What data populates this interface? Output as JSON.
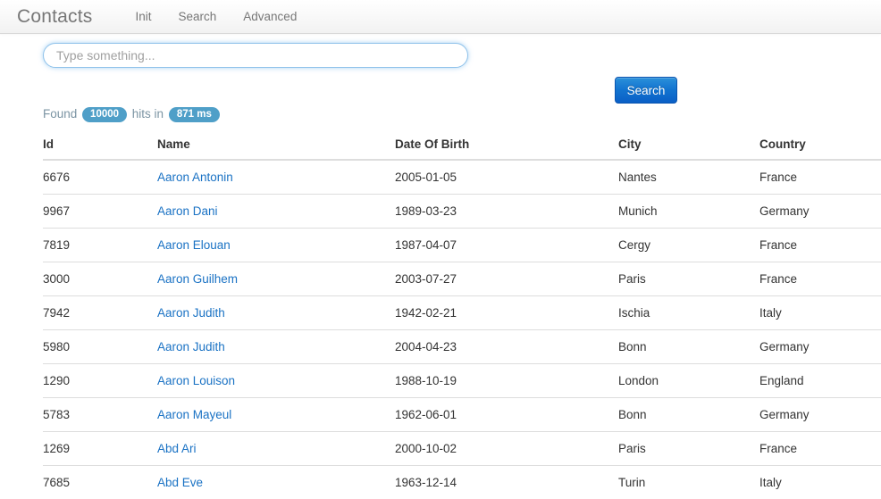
{
  "navbar": {
    "brand": "Contacts",
    "links": [
      {
        "label": "Init"
      },
      {
        "label": "Search"
      },
      {
        "label": "Advanced"
      }
    ]
  },
  "search": {
    "placeholder": "Type something...",
    "value": "",
    "button_label": "Search"
  },
  "hits": {
    "prefix": "Found",
    "count": "10000",
    "middle": "hits in",
    "time": "871 ms"
  },
  "table": {
    "headers": {
      "id": "Id",
      "name": "Name",
      "dob": "Date Of Birth",
      "city": "City",
      "country": "Country"
    },
    "rows": [
      {
        "id": "6676",
        "name": "Aaron Antonin",
        "dob": "2005-01-05",
        "city": "Nantes",
        "country": "France"
      },
      {
        "id": "9967",
        "name": "Aaron Dani",
        "dob": "1989-03-23",
        "city": "Munich",
        "country": "Germany"
      },
      {
        "id": "7819",
        "name": "Aaron Elouan",
        "dob": "1987-04-07",
        "city": "Cergy",
        "country": "France"
      },
      {
        "id": "3000",
        "name": "Aaron Guilhem",
        "dob": "2003-07-27",
        "city": "Paris",
        "country": "France"
      },
      {
        "id": "7942",
        "name": "Aaron Judith",
        "dob": "1942-02-21",
        "city": "Ischia",
        "country": "Italy"
      },
      {
        "id": "5980",
        "name": "Aaron Judith",
        "dob": "2004-04-23",
        "city": "Bonn",
        "country": "Germany"
      },
      {
        "id": "1290",
        "name": "Aaron Louison",
        "dob": "1988-10-19",
        "city": "London",
        "country": "England"
      },
      {
        "id": "5783",
        "name": "Aaron Mayeul",
        "dob": "1962-06-01",
        "city": "Bonn",
        "country": "Germany"
      },
      {
        "id": "1269",
        "name": "Abd Ari",
        "dob": "2000-10-02",
        "city": "Paris",
        "country": "France"
      },
      {
        "id": "7685",
        "name": "Abd Eve",
        "dob": "1963-12-14",
        "city": "Turin",
        "country": "Italy"
      }
    ]
  },
  "colors": {
    "link": "#1a72c4",
    "badge": "#4f9fc8",
    "button": "#1274d0",
    "muted": "#777777"
  }
}
